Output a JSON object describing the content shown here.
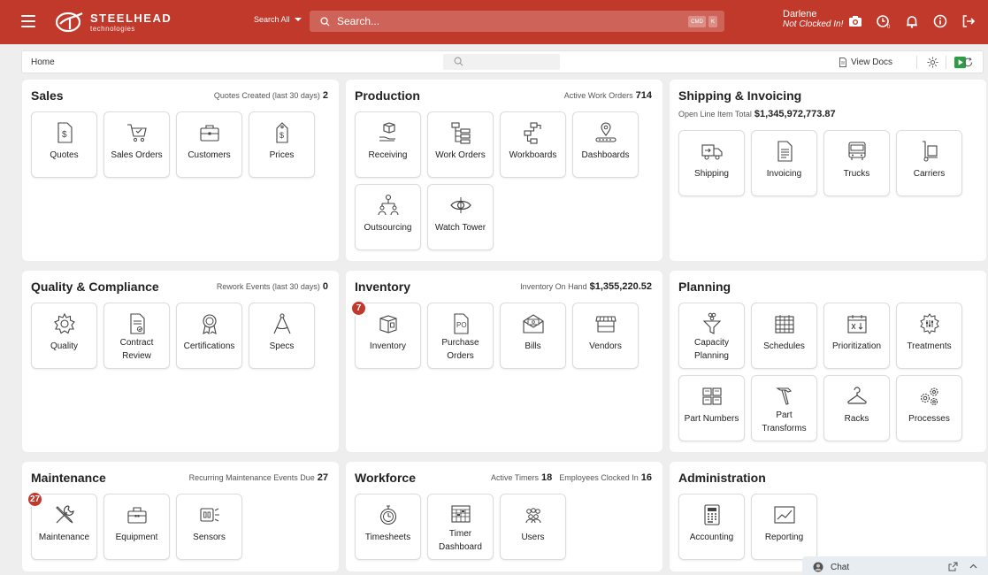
{
  "brand": {
    "name": "STEELHEAD",
    "tagline": "technologies"
  },
  "topbar": {
    "search_scope": "Search All",
    "search_placeholder": "Search...",
    "kbd_cmd": "CMD",
    "kbd_key": "K",
    "user_name": "Darlene",
    "user_status": "Not Clocked In!"
  },
  "subheader": {
    "breadcrumb": "Home",
    "view_docs": "View Docs"
  },
  "colors": {
    "brand": "#c0392b",
    "badge": "#c0392b",
    "play": "#2e9c47"
  },
  "sales": {
    "title": "Sales",
    "stat_label": "Quotes Created (last 30 days)",
    "stat_value": "2",
    "tiles": [
      {
        "label": "Quotes",
        "icon": "quote-document-icon"
      },
      {
        "label": "Sales Orders",
        "icon": "cart-icon"
      },
      {
        "label": "Customers",
        "icon": "briefcase-icon"
      },
      {
        "label": "Prices",
        "icon": "price-tag-icon"
      }
    ]
  },
  "production": {
    "title": "Production",
    "stat_label": "Active Work Orders",
    "stat_value": "714",
    "tiles": [
      {
        "label": "Receiving",
        "icon": "box-hand-icon"
      },
      {
        "label": "Work Orders",
        "icon": "tree-list-icon"
      },
      {
        "label": "Workboards",
        "icon": "workflow-icon"
      },
      {
        "label": "Dashboards",
        "icon": "map-pin-conveyor-icon"
      },
      {
        "label": "Outsourcing",
        "icon": "org-chart-icon"
      },
      {
        "label": "Watch Tower",
        "icon": "eye-icon"
      }
    ]
  },
  "shipping": {
    "title": "Shipping & Invoicing",
    "stat_label": "Open Line Item Total",
    "stat_value": "$1,345,972,773.87",
    "tiles": [
      {
        "label": "Shipping",
        "icon": "delivery-truck-icon"
      },
      {
        "label": "Invoicing",
        "icon": "invoice-icon"
      },
      {
        "label": "Trucks",
        "icon": "bus-icon"
      },
      {
        "label": "Carriers",
        "icon": "hand-truck-icon"
      }
    ]
  },
  "quality": {
    "title": "Quality & Compliance",
    "stat_label": "Rework Events (last 30 days)",
    "stat_value": "0",
    "tiles": [
      {
        "label": "Quality",
        "icon": "gear-icon"
      },
      {
        "label": "Contract Review",
        "line1": "Contract",
        "line2": "Review",
        "icon": "contract-icon"
      },
      {
        "label": "Certifications",
        "icon": "award-icon"
      },
      {
        "label": "Specs",
        "icon": "compass-icon"
      }
    ]
  },
  "inventory": {
    "title": "Inventory",
    "stat_label": "Inventory On Hand",
    "stat_value": "$1,355,220.52",
    "tiles": [
      {
        "label": "Inventory",
        "icon": "open-box-icon",
        "badge": "7"
      },
      {
        "label": "Purchase Orders",
        "line1": "Purchase",
        "line2": "Orders",
        "icon": "po-document-icon"
      },
      {
        "label": "Bills",
        "icon": "envelope-money-icon"
      },
      {
        "label": "Vendors",
        "icon": "storefront-icon"
      }
    ]
  },
  "planning": {
    "title": "Planning",
    "tiles": [
      {
        "label": "Capacity Planning",
        "line1": "Capacity",
        "line2": "Planning",
        "icon": "funnel-icon"
      },
      {
        "label": "Schedules",
        "icon": "calendar-grid-icon"
      },
      {
        "label": "Prioritization",
        "icon": "calendar-sort-icon"
      },
      {
        "label": "Treatments",
        "icon": "gear-sliders-icon"
      },
      {
        "label": "Part Numbers",
        "icon": "grid-boxes-icon"
      },
      {
        "label": "Part Transforms",
        "line1": "Part",
        "line2": "Transforms",
        "icon": "hammer-icon"
      },
      {
        "label": "Racks",
        "icon": "hanger-icon"
      },
      {
        "label": "Processes",
        "icon": "gears-icon"
      }
    ]
  },
  "maintenance": {
    "title": "Maintenance",
    "stat_label": "Recurring Maintenance Events Due",
    "stat_value": "27",
    "tiles": [
      {
        "label": "Maintenance",
        "icon": "tools-icon",
        "badge": "27"
      },
      {
        "label": "Equipment",
        "icon": "toolbox-icon"
      },
      {
        "label": "Sensors",
        "icon": "sensor-icon"
      }
    ]
  },
  "workforce": {
    "title": "Workforce",
    "stat1_label": "Active Timers",
    "stat1_value": "18",
    "stat2_label": "Employees Clocked In",
    "stat2_value": "16",
    "tiles": [
      {
        "label": "Timesheets",
        "icon": "stopwatch-icon"
      },
      {
        "label": "Timer Dashboard",
        "line1": "Timer",
        "line2": "Dashboard",
        "icon": "dashboard-grid-icon"
      },
      {
        "label": "Users",
        "icon": "users-icon"
      }
    ]
  },
  "administration": {
    "title": "Administration",
    "tiles": [
      {
        "label": "Accounting",
        "icon": "calculator-icon"
      },
      {
        "label": "Reporting",
        "icon": "line-chart-icon"
      }
    ]
  },
  "chat": {
    "label": "Chat"
  }
}
